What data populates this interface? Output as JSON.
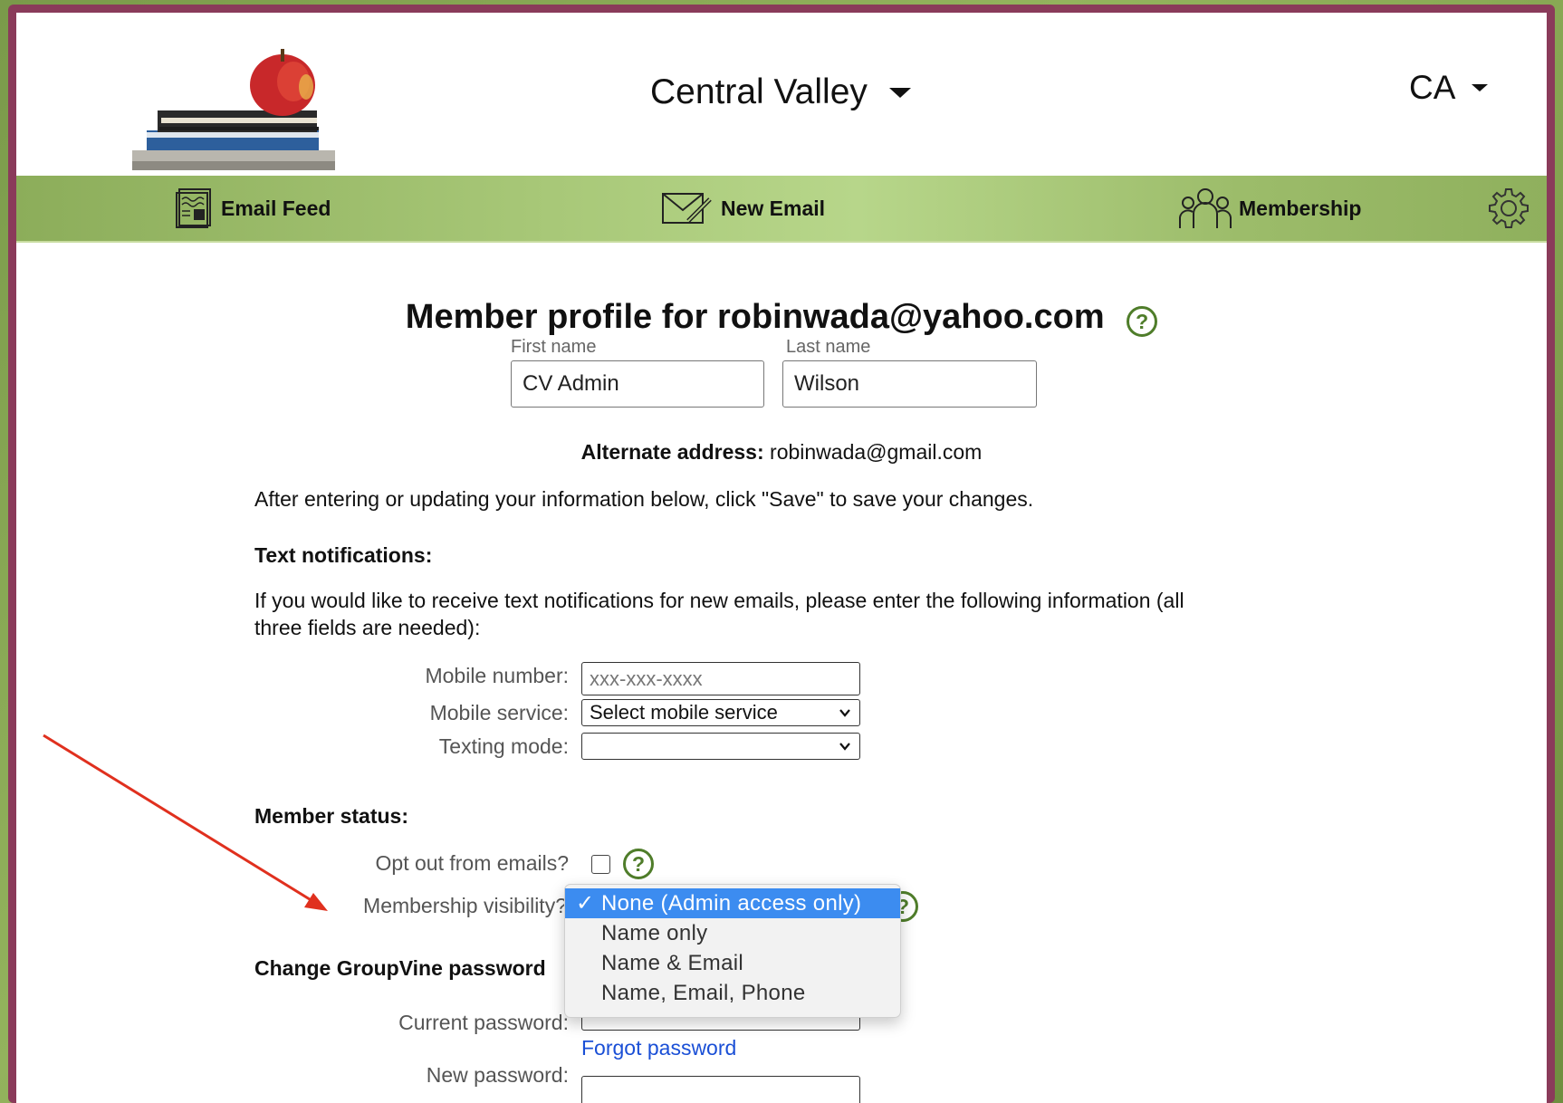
{
  "header": {
    "site_name": "Central Valley",
    "state": "CA"
  },
  "nav": {
    "email_feed": "Email Feed",
    "new_email": "New Email",
    "membership": "Membership"
  },
  "profile": {
    "title": "Member profile for robinwada@yahoo.com",
    "first_name_label": "First name",
    "first_name_value": "CV Admin",
    "last_name_label": "Last name",
    "last_name_value": "Wilson",
    "alternate_label": "Alternate address:",
    "alternate_value": "robinwada@gmail.com"
  },
  "instructions": "After entering or updating your information below, click \"Save\" to save your changes.",
  "text_notifications": {
    "heading": "Text notifications:",
    "description_line1": "If you would like to receive text notifications for new emails, please enter the following information (all",
    "description_line2": "three fields are needed):",
    "mobile_number_label": "Mobile number:",
    "mobile_number_placeholder": "xxx-xxx-xxxx",
    "mobile_service_label": "Mobile service:",
    "mobile_service_value": "Select mobile service",
    "texting_mode_label": "Texting mode:",
    "texting_mode_value": ""
  },
  "member_status": {
    "heading": "Member status:",
    "opt_out_label": "Opt out from emails?",
    "opt_out_checked": false,
    "visibility_label": "Membership visibility?",
    "visibility_options": [
      "None (Admin access only)",
      "Name only",
      "Name & Email",
      "Name, Email, Phone"
    ],
    "visibility_selected_index": 0,
    "check_mark": "✓"
  },
  "password": {
    "heading": "Change GroupVine password",
    "current_label": "Current password:",
    "forgot_link": "Forgot password",
    "new_label": "New password:"
  },
  "colors": {
    "accent_green": "#4f7d2a",
    "nav_green": "#a8c878",
    "frame": "#8a3b5a",
    "link_blue": "#1a4fd6",
    "select_blue": "#3c8cf0",
    "annotation_red": "#e0301e"
  }
}
